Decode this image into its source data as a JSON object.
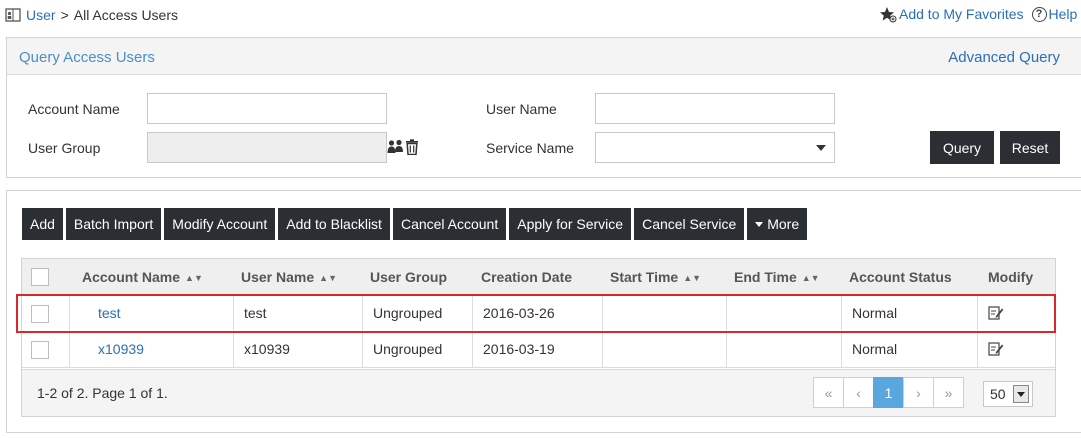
{
  "breadcrumb": {
    "root": "User",
    "separator": ">",
    "current": "All Access Users"
  },
  "header_actions": {
    "favorites": "Add to My Favorites",
    "help": "Help"
  },
  "query_panel": {
    "title": "Query Access Users",
    "advanced_link": "Advanced Query",
    "fields": {
      "account_name": {
        "label": "Account Name",
        "value": ""
      },
      "user_name": {
        "label": "User Name",
        "value": ""
      },
      "user_group": {
        "label": "User Group",
        "value": ""
      },
      "service_name": {
        "label": "Service Name",
        "value": ""
      }
    },
    "query_button": "Query",
    "reset_button": "Reset"
  },
  "toolbar": {
    "add": "Add",
    "batch_import": "Batch Import",
    "modify_account": "Modify Account",
    "add_to_blacklist": "Add to Blacklist",
    "cancel_account": "Cancel Account",
    "apply_for_service": "Apply for Service",
    "cancel_service": "Cancel Service",
    "more": "More"
  },
  "table": {
    "columns": {
      "account_name": "Account Name",
      "user_name": "User Name",
      "user_group": "User Group",
      "creation_date": "Creation Date",
      "start_time": "Start Time",
      "end_time": "End Time",
      "account_status": "Account Status",
      "modify": "Modify"
    },
    "rows": [
      {
        "account_name": "test",
        "user_name": "test",
        "user_group": "Ungrouped",
        "creation_date": "2016-03-26",
        "start_time": "",
        "end_time": "",
        "account_status": "Normal"
      },
      {
        "account_name": "x10939",
        "user_name": "x10939",
        "user_group": "Ungrouped",
        "creation_date": "2016-03-19",
        "start_time": "",
        "end_time": "",
        "account_status": "Normal"
      }
    ]
  },
  "pagination": {
    "summary": "1-2 of 2. Page 1 of 1.",
    "first": "«",
    "prev": "‹",
    "current_page": "1",
    "next": "›",
    "last": "»",
    "page_size": "50"
  },
  "colors": {
    "link": "#2a6fb6",
    "dark_button": "#2b2e33",
    "active_page": "#5aa6de",
    "highlight": "#d8282c"
  }
}
